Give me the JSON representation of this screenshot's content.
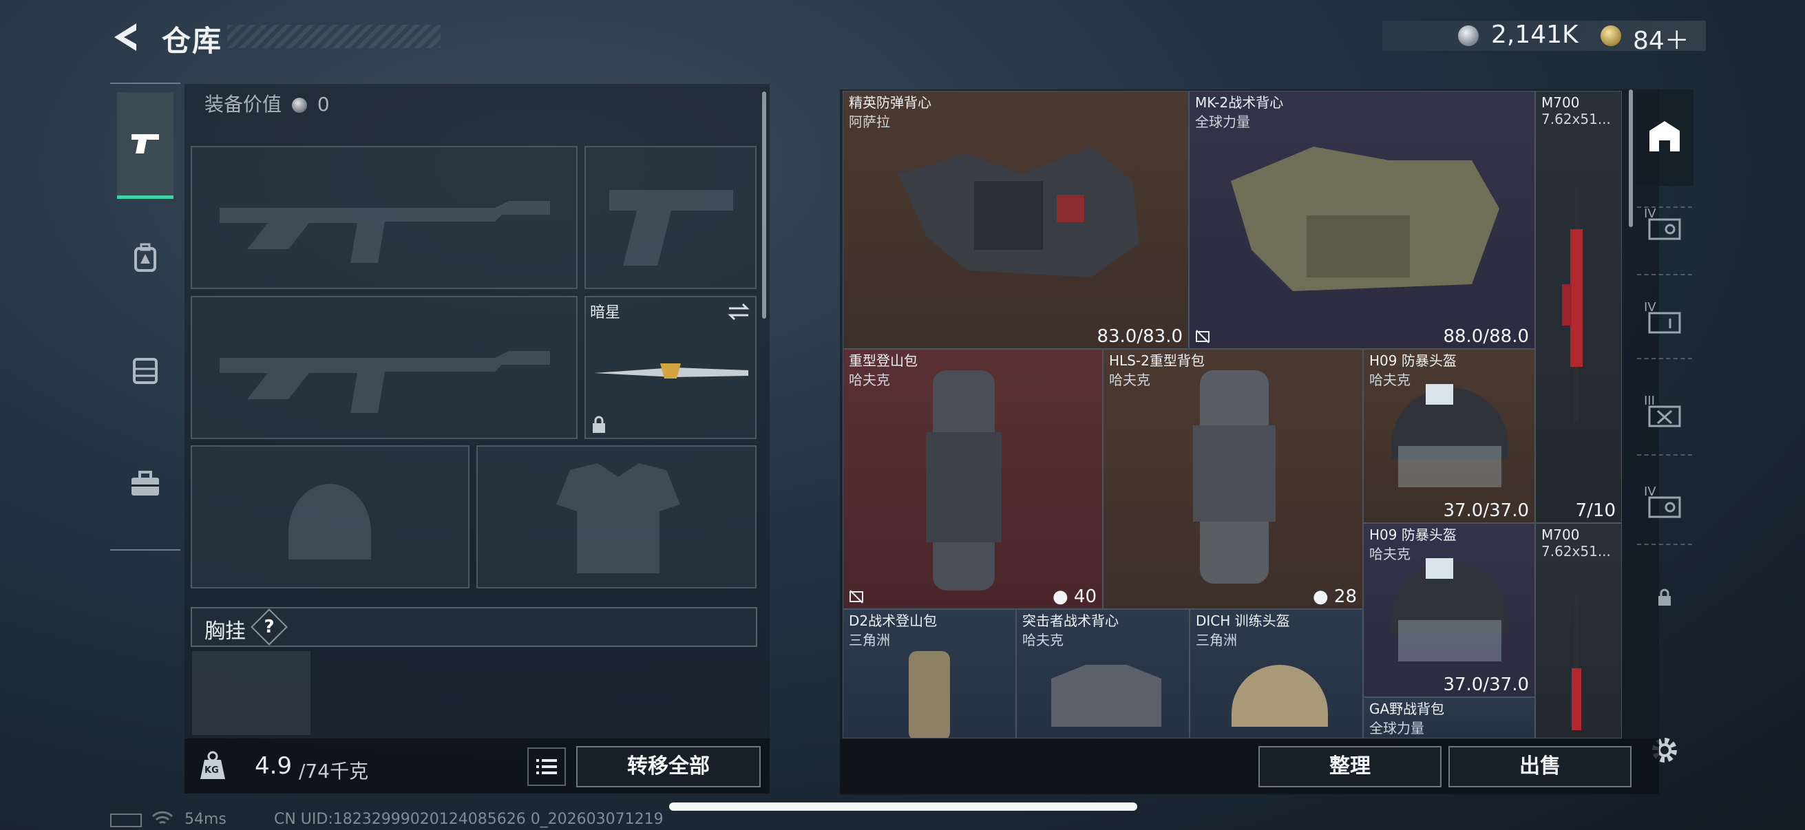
{
  "header": {
    "title": "仓库",
    "currency": [
      {
        "icon": "silver-coin-icon",
        "value": "2,141K"
      },
      {
        "icon": "gold-coin-icon",
        "value": "84＋"
      }
    ]
  },
  "sidebar": {
    "tabs": [
      {
        "name": "pistol-icon",
        "active": true
      },
      {
        "name": "backpack-icon",
        "active": false
      },
      {
        "name": "chest-rig-icon",
        "active": false
      },
      {
        "name": "toolbox-icon",
        "active": false
      }
    ]
  },
  "loadout": {
    "equip_value_label": "装备价值",
    "equip_value": "0",
    "knife_name": "暗星",
    "chest_rig_label": "胸挂",
    "help": "?",
    "weight_value": "4.9",
    "weight_unit": "/74千克",
    "weight_badge": "KG",
    "transfer_all": "转移全部"
  },
  "items": [
    {
      "name": "精英防弹背心",
      "brand": "阿萨拉",
      "durability": "83.0/83.0",
      "color": "brown"
    },
    {
      "name": "MK-2战术背心",
      "brand": "全球力量",
      "durability": "88.0/88.0",
      "color": "purple"
    },
    {
      "name": "M700",
      "brand": "7.62x51...",
      "count": "7/10",
      "color": "dark"
    },
    {
      "name": "重型登山包",
      "brand": "哈夫克",
      "capacity": "40",
      "color": "red"
    },
    {
      "name": "HLS-2重型背包",
      "brand": "哈夫克",
      "capacity": "28",
      "color": "brown"
    },
    {
      "name": "H09 防暴头盔",
      "brand": "哈夫克",
      "durability": "37.0/37.0",
      "color": "brown"
    },
    {
      "name": "H09 防暴头盔",
      "brand": "哈夫克",
      "durability": "37.0/37.0",
      "color": "purple"
    },
    {
      "name": "M700",
      "brand": "7.62x51...",
      "color": "dark"
    },
    {
      "name": "D2战术登山包",
      "brand": "三角洲",
      "color": "blue"
    },
    {
      "name": "突击者战术背心",
      "brand": "哈夫克",
      "color": "blue"
    },
    {
      "name": "DICH 训练头盔",
      "brand": "三角洲",
      "color": "blue"
    },
    {
      "name": "GA野战背包",
      "brand": "全球力量",
      "color": "blue"
    }
  ],
  "rail": {
    "labels": [
      "IV",
      "IV",
      "III",
      "IV"
    ],
    "icons": [
      "warehouse-icon",
      "case-icon",
      "case-icon",
      "case-icon",
      "case-icon",
      "lock-icon",
      "settings-icon"
    ]
  },
  "actions": {
    "sort": "整理",
    "sell": "出售"
  },
  "status": {
    "ping": "54ms",
    "uid": "CN UID:18232999020124085626 0_202603071219"
  },
  "colors": {
    "accent": "#3ed2a5",
    "brown": "#4b3a31",
    "purple": "#34334a",
    "red": "#5a3034",
    "blue": "#2c3a4c"
  }
}
